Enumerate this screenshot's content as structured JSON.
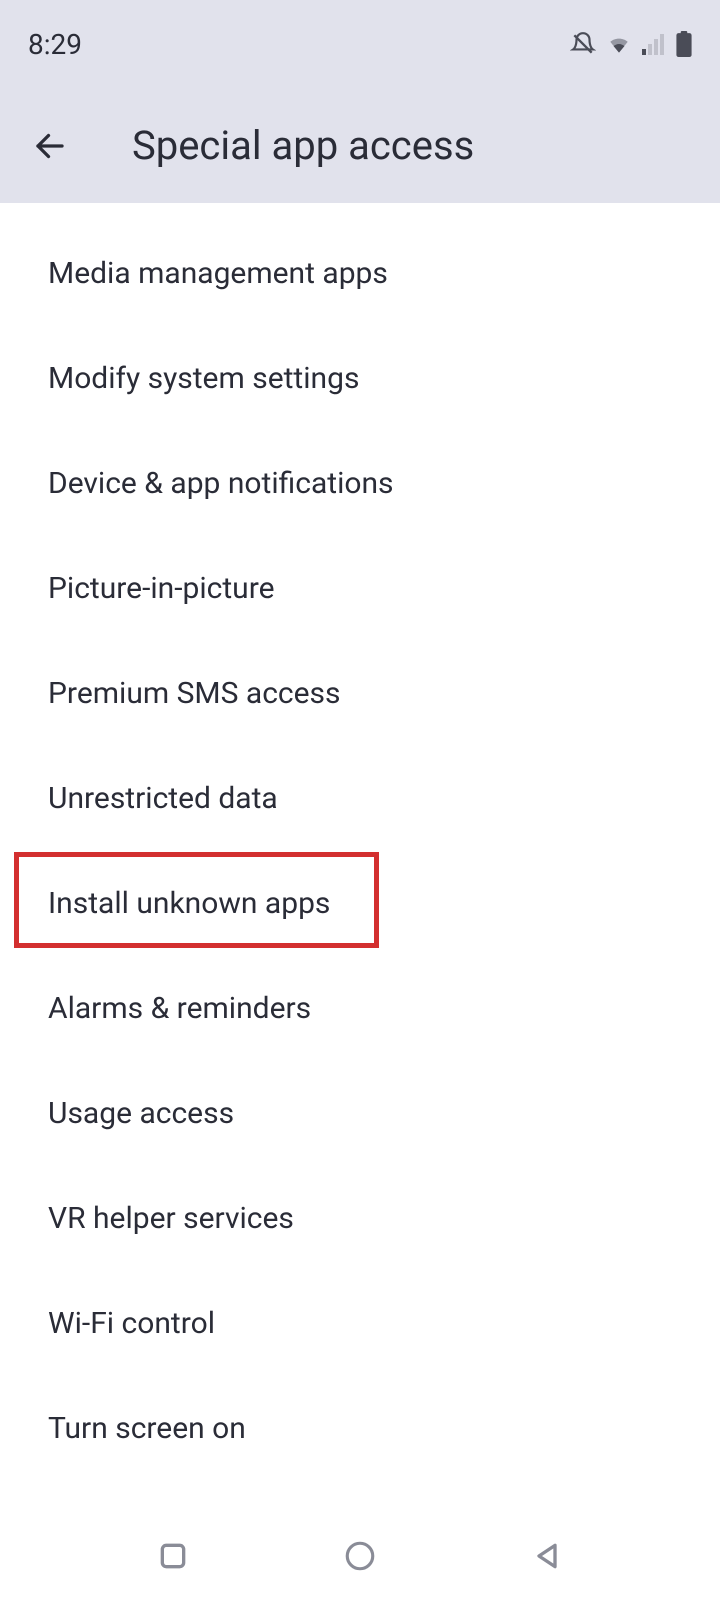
{
  "status": {
    "time": "8:29"
  },
  "header": {
    "title": "Special app access"
  },
  "items": [
    {
      "label": "Media management apps"
    },
    {
      "label": "Modify system settings"
    },
    {
      "label": "Device & app notifications"
    },
    {
      "label": "Picture-in-picture"
    },
    {
      "label": "Premium SMS access"
    },
    {
      "label": "Unrestricted data"
    },
    {
      "label": "Install unknown apps"
    },
    {
      "label": "Alarms & reminders"
    },
    {
      "label": "Usage access"
    },
    {
      "label": "VR helper services"
    },
    {
      "label": "Wi-Fi control"
    },
    {
      "label": "Turn screen on"
    }
  ],
  "highlighted_index": 6
}
